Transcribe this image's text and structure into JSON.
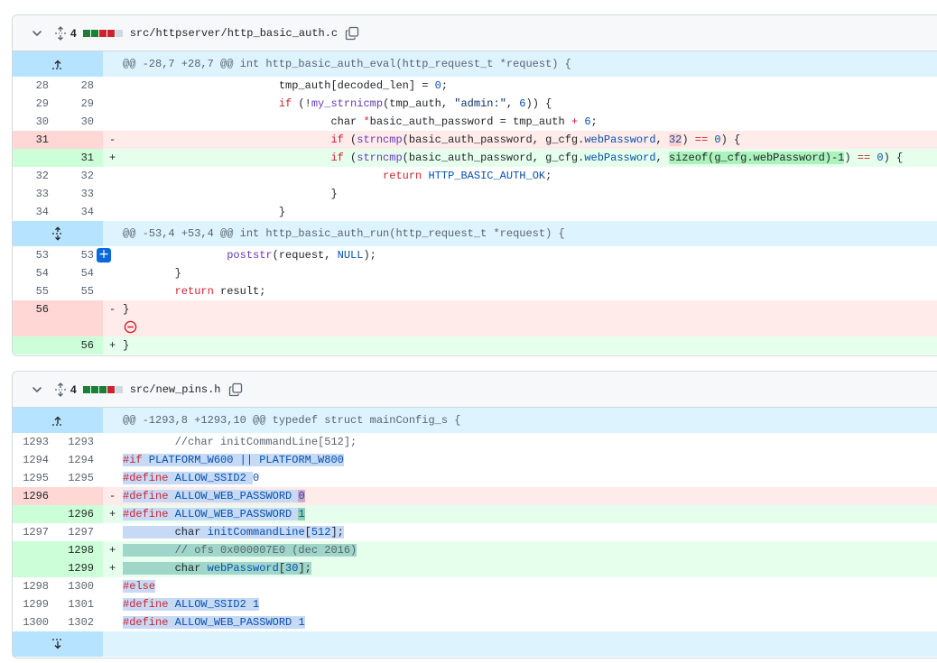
{
  "files": [
    {
      "count": "4",
      "blocks": [
        "#1a7f37",
        "#1a7f37",
        "#cf222e",
        "#cf222e",
        "#d1d9e0"
      ],
      "name": "src/httpserver/http_basic_auth.c",
      "hunks": [
        {
          "header": "@@ -28,7 +28,7 @@ int http_basic_auth_eval(http_request_t *request) {"
        },
        {
          "header": "@@ -53,4 +53,4 @@ int http_basic_auth_run(http_request_t *request) {"
        }
      ],
      "lines": [
        {
          "old": "28",
          "new": "28"
        },
        {
          "old": "29",
          "new": "29"
        },
        {
          "old": "30",
          "new": "30"
        },
        {
          "old": "31",
          "new": "",
          "mark": "-"
        },
        {
          "old": "",
          "new": "31",
          "mark": "+"
        },
        {
          "old": "32",
          "new": "32"
        },
        {
          "old": "33",
          "new": "33"
        },
        {
          "old": "34",
          "new": "34"
        },
        {
          "old": "53",
          "new": "53"
        },
        {
          "old": "54",
          "new": "54"
        },
        {
          "old": "55",
          "new": "55"
        },
        {
          "old": "56",
          "new": "",
          "mark": "-"
        },
        {
          "old": "",
          "new": "56",
          "mark": "+"
        }
      ],
      "code": {
        "l28": "                        tmp_auth[decoded_len] = ",
        "l28b": "0",
        "l28c": ";",
        "l29a": "                        ",
        "l29kw": "if",
        "l29b": " (!",
        "l29fn": "my_strnicmp",
        "l29c": "(tmp_auth, ",
        "l29st": "\"admin:\"",
        "l29d": ", ",
        "l29n": "6",
        "l29e": ")) {",
        "l30a": "                                char ",
        "l30op": "*",
        "l30b": "basic_auth_password = tmp_auth ",
        "l30op2": "+",
        "l30c": " ",
        "l30n": "6",
        "l30d": ";",
        "l31a": "                                ",
        "l31kw": "if",
        "l31b": " (",
        "l31fn": "strncmp",
        "l31c": "(basic_auth_password, g_cfg.",
        "l31pr": "webPassword",
        "l31d": ", ",
        "l31hl": "32",
        "l31e": ") ",
        "l31op": "==",
        "l31f": " ",
        "l31n": "0",
        "l31g": ") {",
        "l31nb": " (",
        "l31nhl": "sizeof(g_cfg.webPassword)-1",
        "l31ne": ") ",
        "l32a": "                                        ",
        "l32kw": "return",
        "l32b": " ",
        "l32cn": "HTTP_BASIC_AUTH_OK",
        "l32c": ";",
        "l33": "                                }",
        "l34": "                        }",
        "l53a": "                ",
        "l53fn": "poststr",
        "l53b": "(request, ",
        "l53cn": "NULL",
        "l53c": ");",
        "l54": "        }",
        "l55a": "        ",
        "l55kw": "return",
        "l55b": " result;",
        "l56": "}"
      }
    },
    {
      "count": "4",
      "blocks": [
        "#1a7f37",
        "#1a7f37",
        "#1a7f37",
        "#cf222e",
        "#d1d9e0"
      ],
      "name": "src/new_pins.h",
      "hunks": [
        {
          "header": "@@ -1293,8 +1293,10 @@ typedef struct mainConfig_s {"
        }
      ],
      "lines": [
        {
          "old": "1293",
          "new": "1293"
        },
        {
          "old": "1294",
          "new": "1294"
        },
        {
          "old": "1295",
          "new": "1295"
        },
        {
          "old": "1296",
          "new": "",
          "mark": "-"
        },
        {
          "old": "",
          "new": "1296",
          "mark": "+"
        },
        {
          "old": "1297",
          "new": "1297"
        },
        {
          "old": "",
          "new": "1298",
          "mark": "+"
        },
        {
          "old": "",
          "new": "1299",
          "mark": "+"
        },
        {
          "old": "1298",
          "new": "1300"
        },
        {
          "old": "1299",
          "new": "1301"
        },
        {
          "old": "1300",
          "new": "1302"
        }
      ],
      "code": {
        "c1293": "        //char initCommandLine[512];",
        "pp_if": "#if",
        "c1294b": " PLATFORM_W600 || PLATFORM_W800",
        "pp_def": "#define",
        "c1295b": " ALLOW_SSID2 ",
        "c1295n": "0",
        "c1296b": " ALLOW_WEB_PASSWORD ",
        "c1296n": "0",
        "c1296nn": "1",
        "c1297a": "        char ",
        "c1297b": "initCommandLine",
        "c1297c": "[",
        "c1297n": "512",
        "c1297d": "];",
        "c1298a": "        ",
        "c1298b": "// ofs 0x000007E0 (dec 2016)",
        "c1299a": "        char ",
        "c1299b": "webPassword",
        "c1299c": "[",
        "c1299n": "30",
        "c1299d": "];",
        "pp_else": "#else",
        "c1301b": " ALLOW_SSID2 ",
        "c1301n": "1",
        "c1302b": " ALLOW_WEB_PASSWORD ",
        "c1302n": "1"
      }
    }
  ]
}
